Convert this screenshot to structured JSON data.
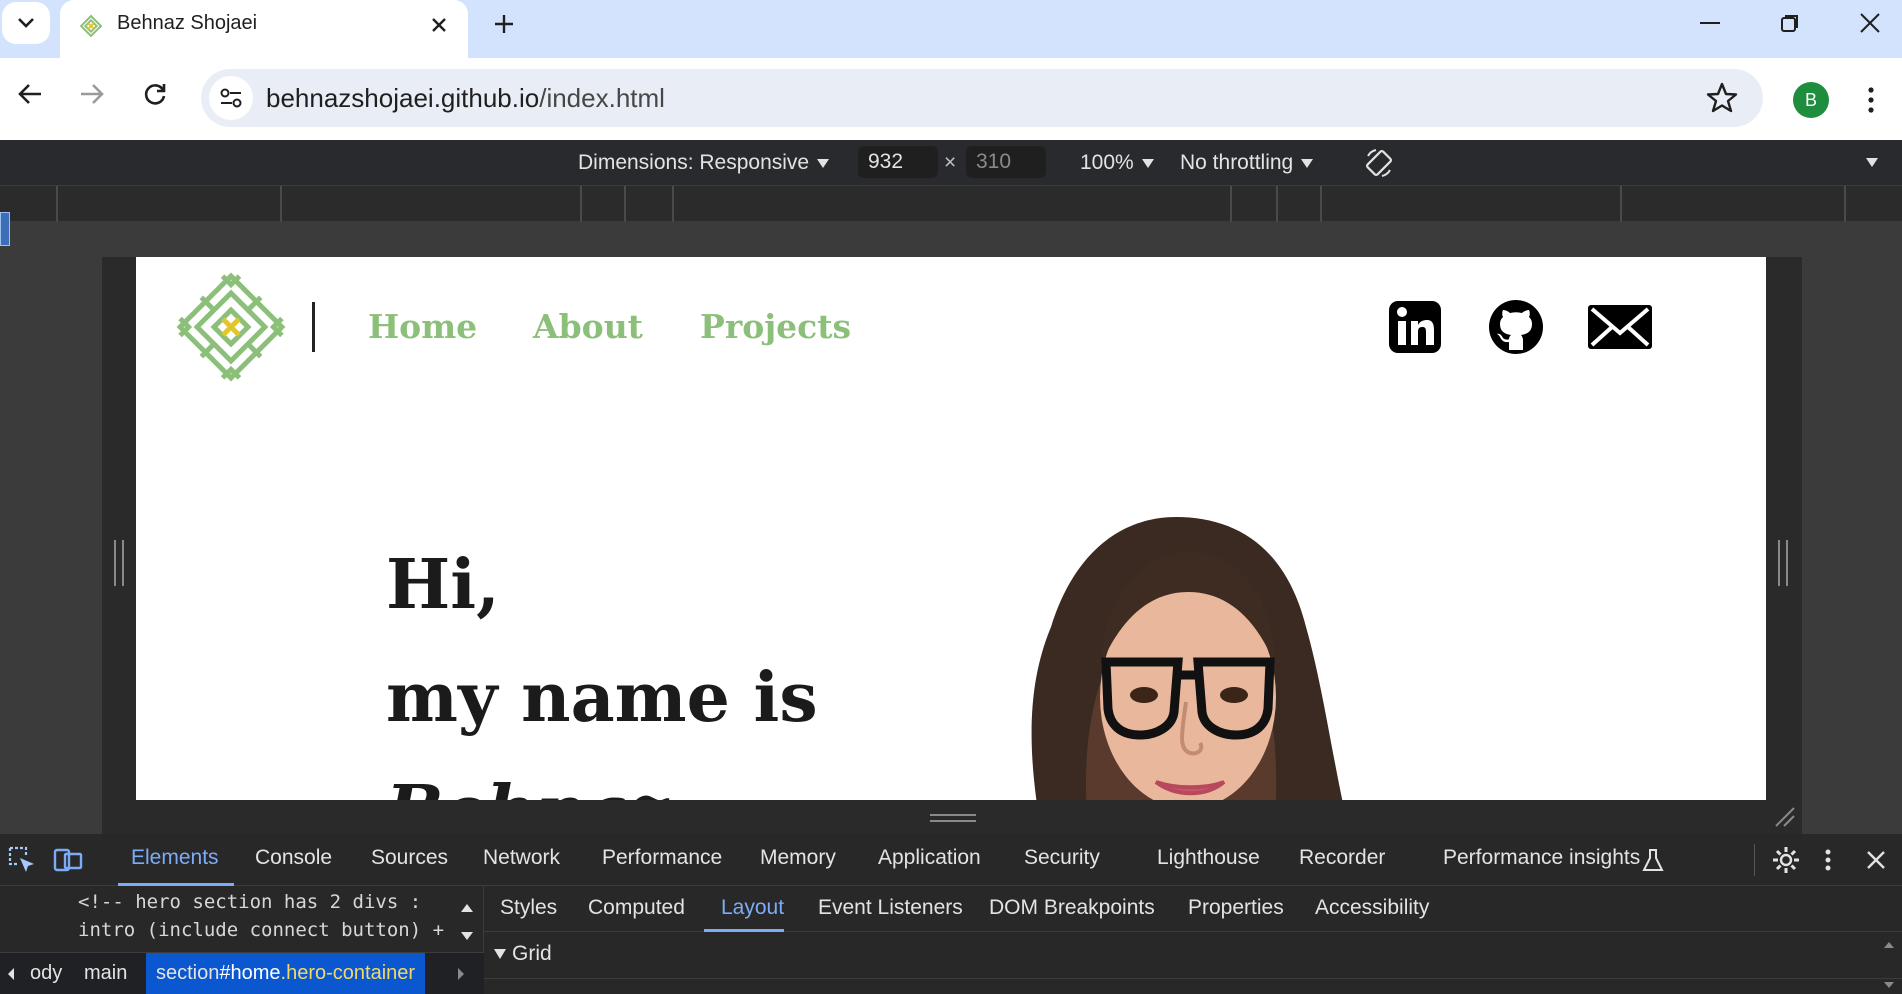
{
  "browser": {
    "tab_title": "Behnaz Shojaei",
    "tab_close": "✕",
    "new_tab": "+",
    "url_host": "behnazshojaei.github.io",
    "url_path": "/index.html",
    "profile_initial": "B",
    "icons": [
      "tab-list-icon",
      "favicon-icon",
      "close-icon",
      "plus-icon",
      "minimize-icon",
      "restore-icon",
      "window-close-icon",
      "back-icon",
      "forward-icon",
      "reload-icon",
      "site-info-icon",
      "star-icon",
      "kebab-menu-icon"
    ]
  },
  "device_toolbar": {
    "dimensions_label": "Dimensions: Responsive",
    "width_value": "932",
    "times": "×",
    "height_value": "310",
    "zoom": "100%",
    "throttling": "No throttling",
    "icons": [
      "rotate-icon",
      "more-options-icon"
    ]
  },
  "site": {
    "nav": [
      "Home",
      "About",
      "Projects"
    ],
    "social": [
      "linkedin-icon",
      "github-icon",
      "mail-icon"
    ],
    "hero_lines": [
      "Hi,",
      "my name is",
      "Behnaz"
    ],
    "colors": {
      "nav": "#8cc07a",
      "logo_green": "#8cc07a",
      "logo_accent": "#e1c62b",
      "hero_text": "#1b1b1b"
    }
  },
  "devtools": {
    "tabs": [
      "Elements",
      "Console",
      "Sources",
      "Network",
      "Performance",
      "Memory",
      "Application",
      "Security",
      "Lighthouse",
      "Recorder",
      "Performance insights"
    ],
    "active_tab": "Elements",
    "html_comment_line1": "<!-- hero section has 2 divs :",
    "html_comment_line2": "intro (include connect button) +",
    "breadcrumb_body": "ody",
    "breadcrumb_main": "main",
    "breadcrumb_active_tag": "section",
    "breadcrumb_active_id": "#home",
    "breadcrumb_active_class": ".hero-container",
    "sub_tabs": [
      "Styles",
      "Computed",
      "Layout",
      "Event Listeners",
      "DOM Breakpoints",
      "Properties",
      "Accessibility"
    ],
    "active_sub_tab": "Layout",
    "grid_section": "Grid",
    "colors": {
      "accent": "#7cacf8",
      "selection": "#0b57d0",
      "class_highlight": "#f2d966"
    }
  }
}
